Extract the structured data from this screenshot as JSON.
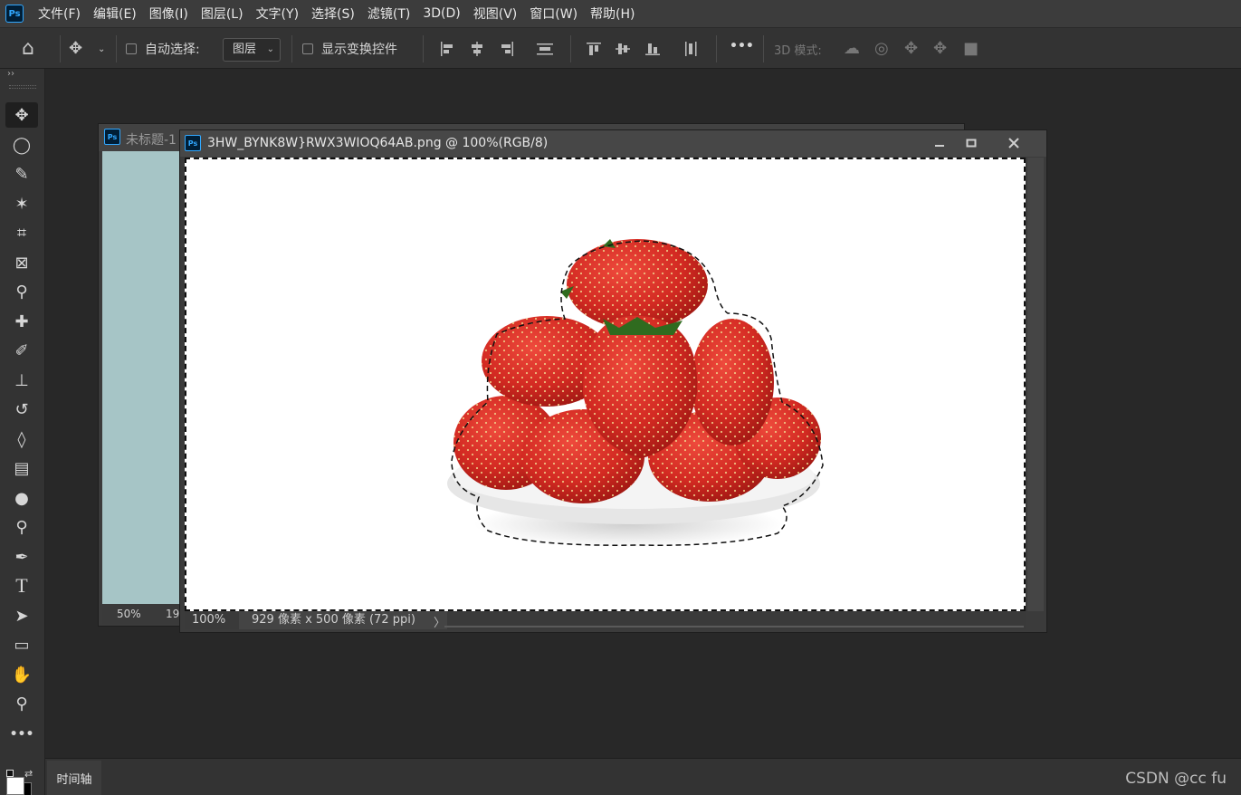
{
  "app": {
    "logo": "Ps",
    "menus": [
      "文件(F)",
      "编辑(E)",
      "图像(I)",
      "图层(L)",
      "文字(Y)",
      "选择(S)",
      "滤镜(T)",
      "3D(D)",
      "视图(V)",
      "窗口(W)",
      "帮助(H)"
    ]
  },
  "options_bar": {
    "auto_select_label": "自动选择:",
    "auto_select_value": "图层",
    "show_transform_label": "显示变换控件",
    "mode_3d_label": "3D 模式:",
    "more_label": "•••"
  },
  "toolbar": {
    "collapse": "››",
    "tools": [
      {
        "name": "move-tool",
        "glyph": "✥"
      },
      {
        "name": "elliptical-marquee-tool",
        "glyph": "◯"
      },
      {
        "name": "lasso-tool",
        "glyph": "✎"
      },
      {
        "name": "magic-wand-tool",
        "glyph": "✶"
      },
      {
        "name": "crop-tool",
        "glyph": "⌗"
      },
      {
        "name": "frame-tool",
        "glyph": "⊠"
      },
      {
        "name": "eyedropper-tool",
        "glyph": "⚲"
      },
      {
        "name": "healing-brush-tool",
        "glyph": "✚"
      },
      {
        "name": "brush-tool",
        "glyph": "✐"
      },
      {
        "name": "clone-stamp-tool",
        "glyph": "⊥"
      },
      {
        "name": "history-brush-tool",
        "glyph": "↺"
      },
      {
        "name": "eraser-tool",
        "glyph": "◊"
      },
      {
        "name": "gradient-tool",
        "glyph": "▤"
      },
      {
        "name": "blur-tool",
        "glyph": "●"
      },
      {
        "name": "dodge-tool",
        "glyph": "⚲"
      },
      {
        "name": "pen-tool",
        "glyph": "✒"
      },
      {
        "name": "type-tool",
        "glyph": "T"
      },
      {
        "name": "path-selection-tool",
        "glyph": "➤"
      },
      {
        "name": "rectangle-tool",
        "glyph": "▭"
      },
      {
        "name": "hand-tool",
        "glyph": "✋"
      },
      {
        "name": "zoom-tool",
        "glyph": "⚲"
      },
      {
        "name": "more-tools",
        "glyph": "•••"
      }
    ]
  },
  "doc_back": {
    "title": "未标题-1",
    "zoom": "50%",
    "status_partial": "19"
  },
  "doc_front": {
    "title": "3HW_BYNK8W}RWX3WIOQ64AB.png @ 100%(RGB/8)",
    "zoom": "100%",
    "info": "929 像素 x 500 像素 (72 ppi)",
    "arrow": "〉"
  },
  "timeline": {
    "tab": "时间轴"
  },
  "watermark": "CSDN @cc fu",
  "colors": {
    "fill_back_canvas": "#a6c5c6",
    "strawberry": "#d32a22",
    "plate": "#ececec"
  }
}
